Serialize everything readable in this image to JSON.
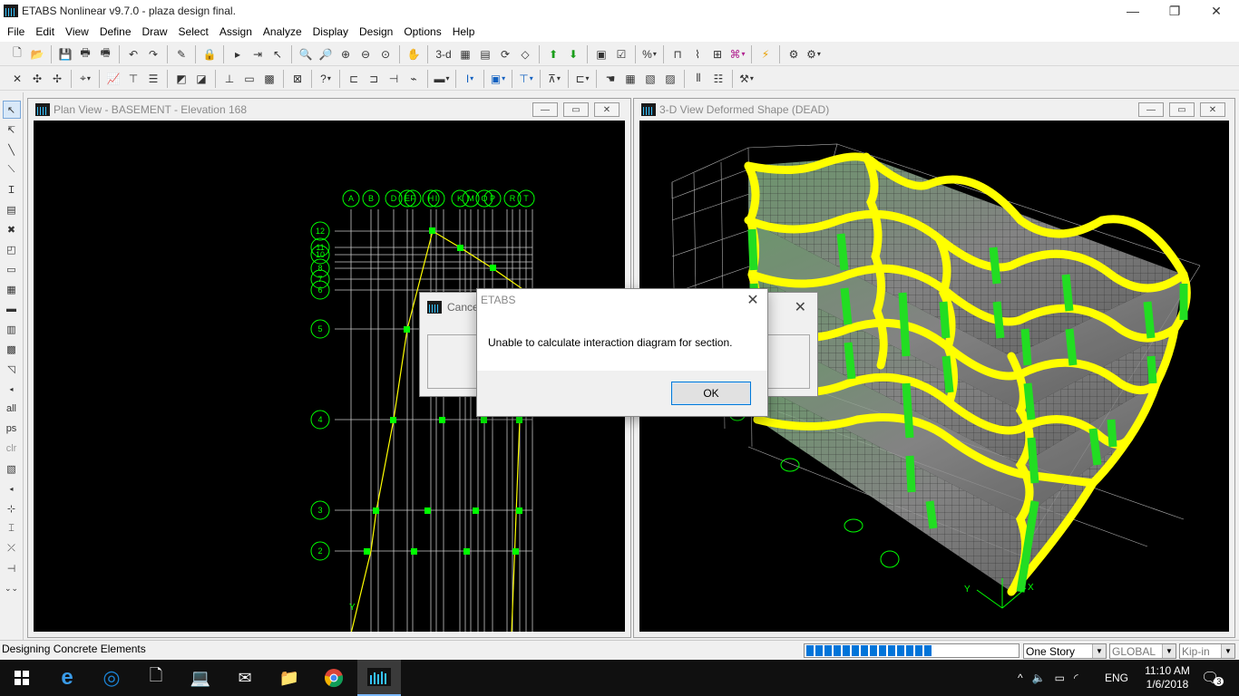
{
  "window": {
    "title": "ETABS Nonlinear v9.7.0 - plaza design final.",
    "min": "—",
    "max": "❐",
    "close": "✕"
  },
  "menu": [
    "File",
    "Edit",
    "View",
    "Define",
    "Draw",
    "Select",
    "Assign",
    "Analyze",
    "Display",
    "Design",
    "Options",
    "Help"
  ],
  "toolbar": {
    "btn_3d": "3-d"
  },
  "plan_view": {
    "title": "Plan View - BASEMENT - Elevation 168",
    "grid_x_labels": [
      "A",
      "B",
      "C",
      "D",
      "E",
      "F",
      "G",
      "H",
      "I",
      "J",
      "K",
      "L",
      "M",
      "N",
      "O",
      "P",
      "Q",
      "R",
      "S",
      "T",
      "U"
    ],
    "grid_y_labels": [
      "12",
      "11",
      "10",
      "9",
      "8",
      "7",
      "6",
      "5",
      "4",
      "3",
      "2"
    ],
    "axis_y": "Y"
  },
  "view_3d": {
    "title": "3-D View  Deformed Shape (DEAD)",
    "axis_x": "X",
    "axis_y": "Y"
  },
  "behind_dialog": {
    "title": "Cance"
  },
  "dialog": {
    "title": "ETABS",
    "message": "Unable to calculate interaction diagram for section.",
    "ok": "OK"
  },
  "status": {
    "text": "Designing Concrete Elements",
    "progress_fraction": 0.61,
    "story_mode": "One Story",
    "coord_system": "GLOBAL",
    "units": "Kip-in"
  },
  "taskbar": {
    "lang": "ENG",
    "time": "11:10 AM",
    "date": "1/6/2018",
    "notifications": "3"
  },
  "colors": {
    "frame_yellow": "#ffff00",
    "column_green": "#22dd22",
    "grid": "#c8c8c8",
    "node": "#00ff00",
    "bubble": "#00ff00"
  }
}
